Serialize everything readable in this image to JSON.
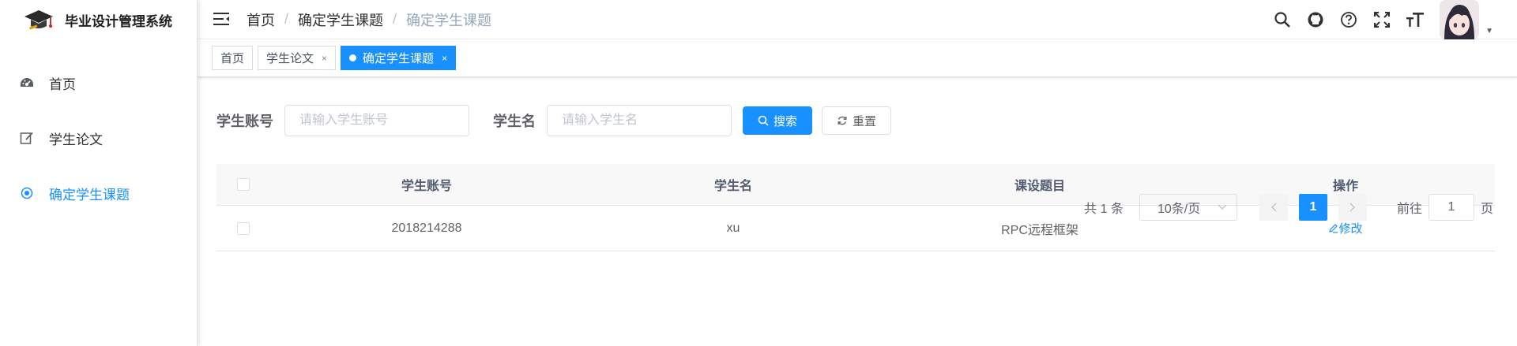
{
  "app": {
    "title": "毕业设计管理系统"
  },
  "sidebar": {
    "items": [
      {
        "label": "首页",
        "icon": "dashboard-icon",
        "active": false
      },
      {
        "label": "学生论文",
        "icon": "edit-icon",
        "active": false
      },
      {
        "label": "确定学生课题",
        "icon": "radio-icon",
        "active": true
      }
    ]
  },
  "header": {
    "breadcrumb": [
      "首页",
      "确定学生课题",
      "确定学生课题"
    ],
    "icons": [
      "search-icon",
      "github-icon",
      "help-icon",
      "fullscreen-icon",
      "font-size-icon"
    ]
  },
  "tags": [
    {
      "label": "首页",
      "closable": false,
      "active": false
    },
    {
      "label": "学生论文",
      "closable": true,
      "active": false
    },
    {
      "label": "确定学生课题",
      "closable": true,
      "active": true
    }
  ],
  "search": {
    "account_label": "学生账号",
    "account_placeholder": "请输入学生账号",
    "name_label": "学生名",
    "name_placeholder": "请输入学生名",
    "search_button": "搜索",
    "reset_button": "重置"
  },
  "table": {
    "columns": [
      "学生账号",
      "学生名",
      "课设题目",
      "操作"
    ],
    "rows": [
      {
        "account": "2018214288",
        "name": "xu",
        "topic": "RPC远程框架",
        "action": "修改"
      }
    ]
  },
  "pagination": {
    "total_text": "共 1 条",
    "page_size": "10条/页",
    "current_page": "1",
    "goto_prefix": "前往",
    "goto_value": "1",
    "goto_suffix": "页"
  },
  "colors": {
    "primary": "#1890ff",
    "text": "#303133",
    "muted": "#97a8be"
  }
}
